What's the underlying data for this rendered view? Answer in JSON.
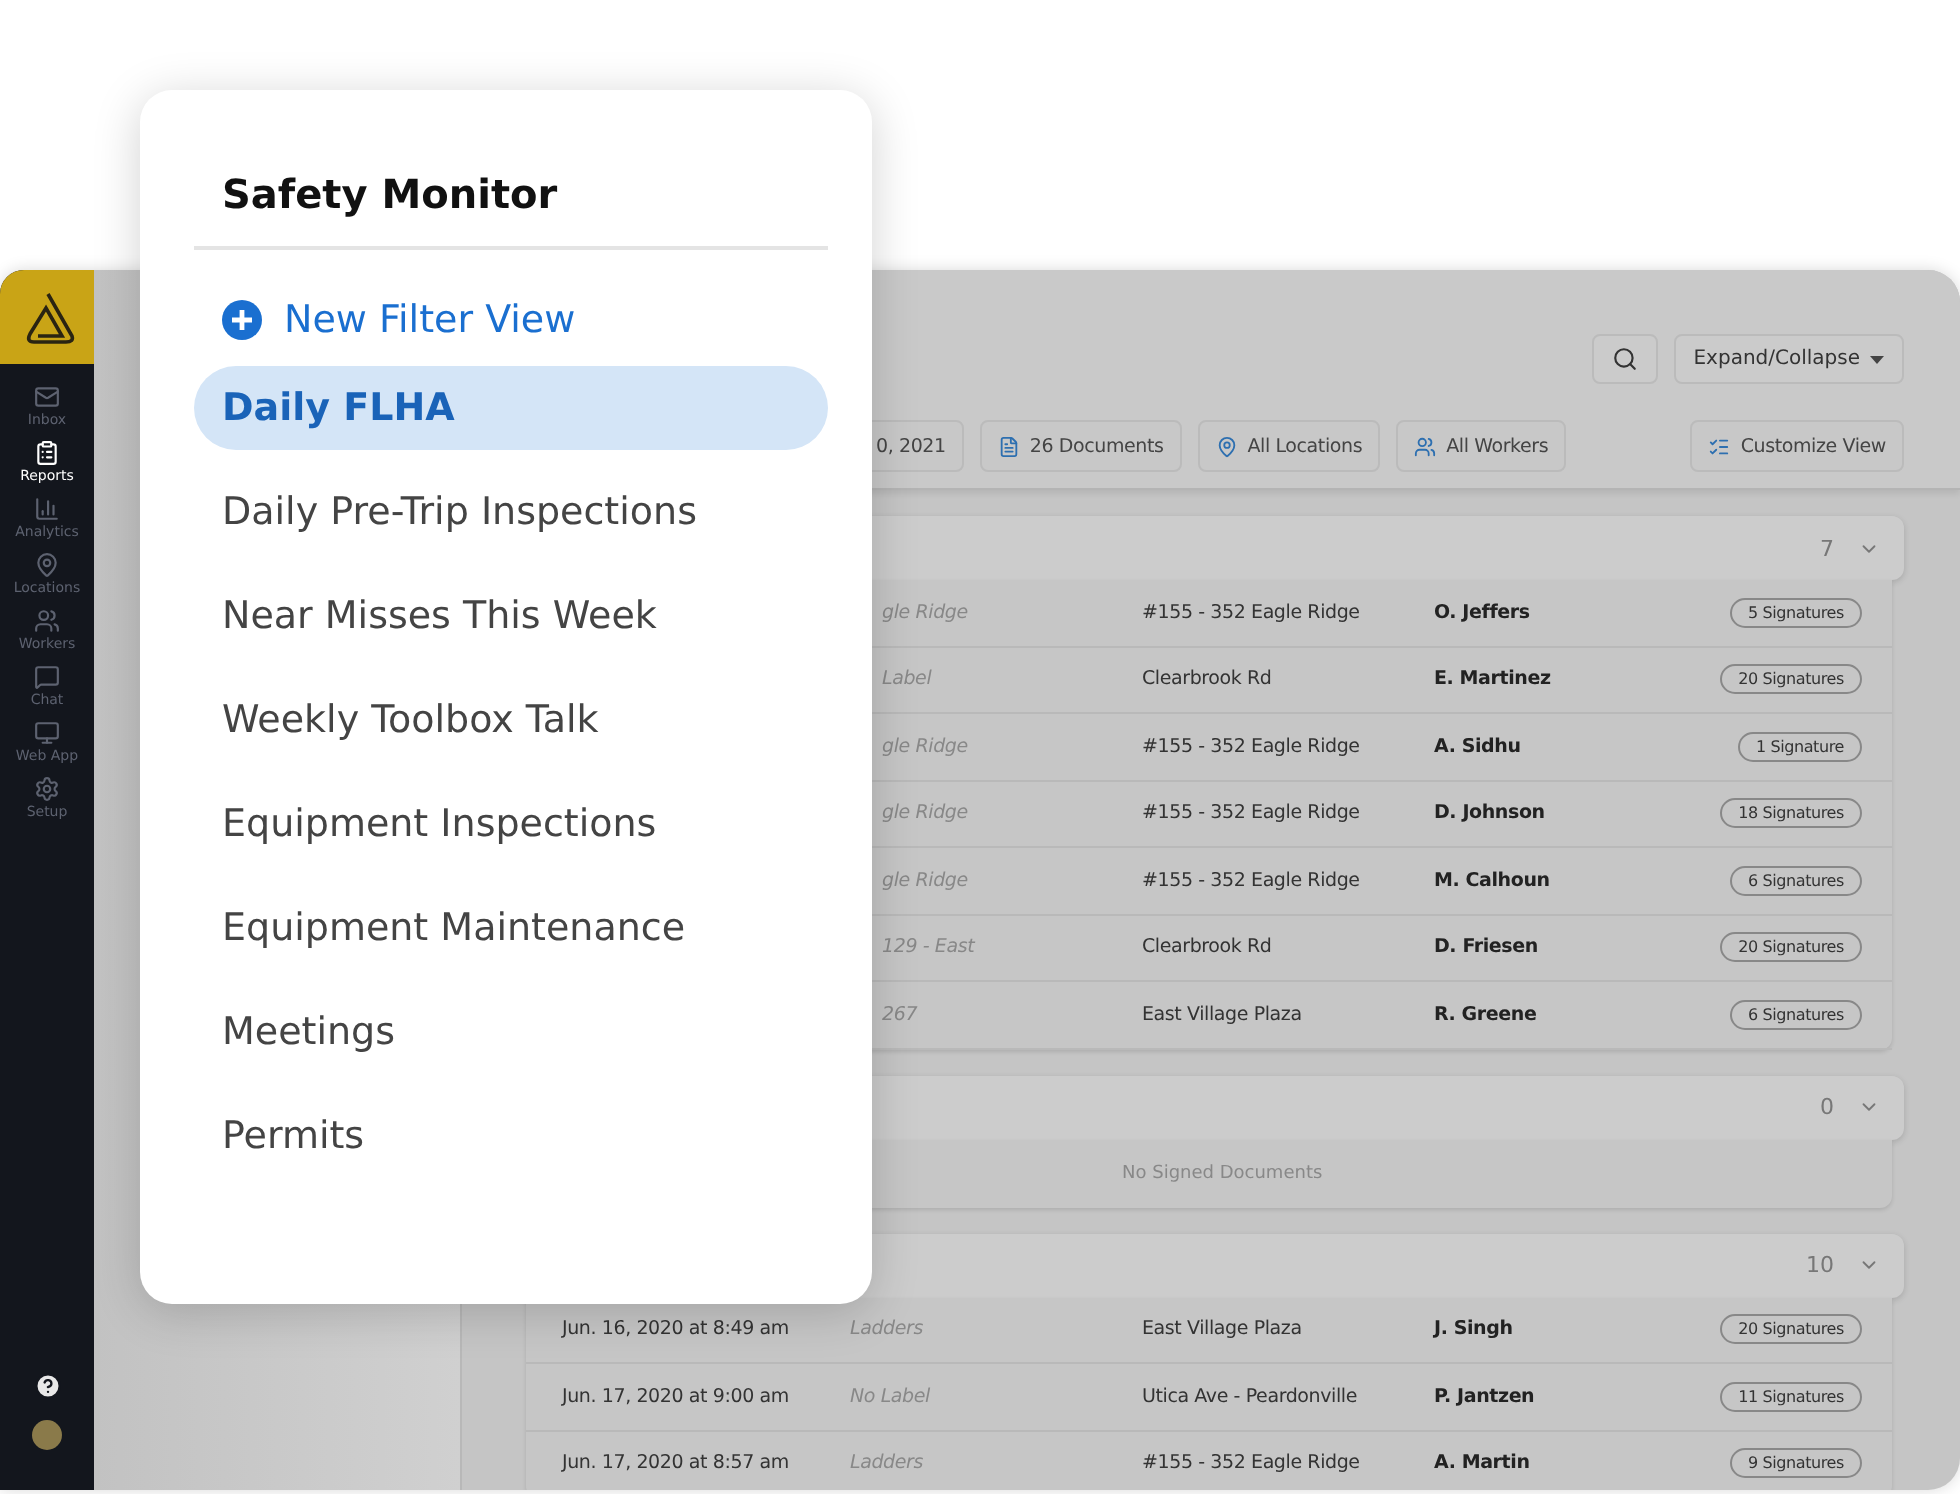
{
  "sidebar": {
    "items": [
      {
        "label": "Inbox",
        "kind": "mail",
        "selected": false
      },
      {
        "label": "Reports",
        "kind": "clipboard",
        "selected": true
      },
      {
        "label": "Analytics",
        "kind": "chart",
        "selected": false
      },
      {
        "label": "Locations",
        "kind": "pin",
        "selected": false
      },
      {
        "label": "Workers",
        "kind": "people",
        "selected": false
      },
      {
        "label": "Chat",
        "kind": "chat",
        "selected": false
      },
      {
        "label": "Web App",
        "kind": "monitor",
        "selected": false
      },
      {
        "label": "Setup",
        "kind": "gear",
        "selected": false
      }
    ]
  },
  "toolbar": {
    "expand_button": "Expand/Collapse"
  },
  "filters": [
    {
      "label": "0, 2021",
      "kind": "date"
    },
    {
      "label": "26 Documents",
      "kind": "documents"
    },
    {
      "label": "All Locations",
      "kind": "locations"
    },
    {
      "label": "All Workers",
      "kind": "workers"
    }
  ],
  "customize_button": "Customize View",
  "groups": [
    {
      "count": "7",
      "rows": [
        {
          "label": "gle Ridge",
          "address": "#155 - 352 Eagle Ridge",
          "worker": "O. Jeffers",
          "signatures": "5 Signatures"
        },
        {
          "label": "Label",
          "address": "Clearbrook Rd",
          "worker": "E. Martinez",
          "signatures": "20 Signatures"
        },
        {
          "label": "gle Ridge",
          "address": "#155 - 352 Eagle Ridge",
          "worker": "A. Sidhu",
          "signatures": "1 Signature"
        },
        {
          "label": "gle Ridge",
          "address": "#155 - 352 Eagle Ridge",
          "worker": "D. Johnson",
          "signatures": "18 Signatures"
        },
        {
          "label": "gle Ridge",
          "address": "#155 - 352 Eagle Ridge",
          "worker": "M. Calhoun",
          "signatures": "6 Signatures"
        },
        {
          "label": "129 - East",
          "address": "Clearbrook Rd",
          "worker": "D. Friesen",
          "signatures": "20 Signatures"
        },
        {
          "label": "267",
          "address": "East Village Plaza",
          "worker": "R. Greene",
          "signatures": "6 Signatures"
        }
      ]
    },
    {
      "count": "0",
      "empty_text": "No Signed Documents"
    },
    {
      "count": "10",
      "rows": [
        {
          "date": "Jun. 16, 2020 at 8:49 am",
          "label": "Ladders",
          "address": "East Village Plaza",
          "worker": "J. Singh",
          "signatures": "20 Signatures"
        },
        {
          "date": "Jun. 17, 2020 at 9:00 am",
          "label": "No Label",
          "address": "Utica Ave - Peardonville",
          "worker": "P. Jantzen",
          "signatures": "11 Signatures"
        },
        {
          "date": "Jun. 17, 2020 at 8:57 am",
          "label": "Ladders",
          "address": "#155 - 352 Eagle Ridge",
          "worker": "A. Martin",
          "signatures": "9 Signatures"
        }
      ]
    }
  ],
  "popup": {
    "title": "Safety Monitor",
    "new_filter": "New Filter View",
    "items": [
      {
        "label": "Daily FLHA",
        "selected": true
      },
      {
        "label": "Daily Pre-Trip Inspections",
        "selected": false
      },
      {
        "label": "Near Misses This Week",
        "selected": false
      },
      {
        "label": "Weekly Toolbox Talk",
        "selected": false
      },
      {
        "label": "Equipment Inspections",
        "selected": false
      },
      {
        "label": "Equipment Maintenance",
        "selected": false
      },
      {
        "label": "Meetings",
        "selected": false
      },
      {
        "label": "Permits",
        "selected": false
      }
    ]
  }
}
